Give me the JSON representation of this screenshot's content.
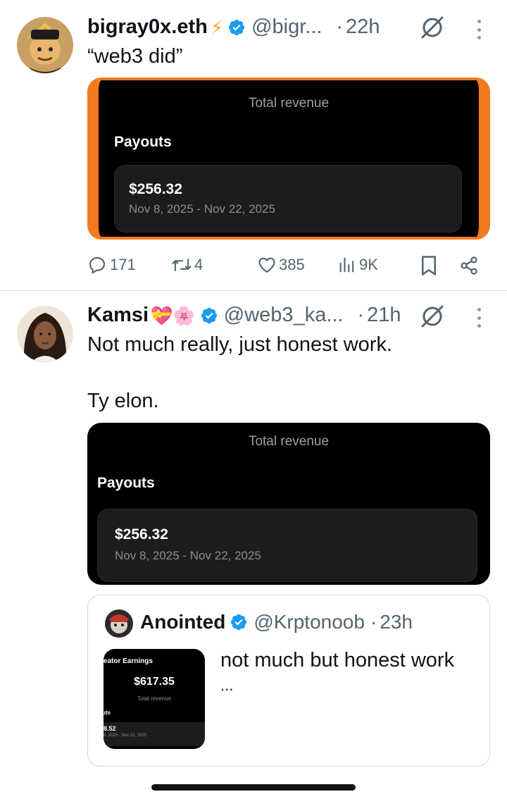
{
  "tweets": [
    {
      "name": "bigray0x.eth",
      "emoji": "⚡",
      "handle": "@bigr...",
      "dot": "·",
      "time": "22h",
      "text": "“web3 did”",
      "media": {
        "title": "Total revenue",
        "section": "Payouts",
        "amount": "$256.32",
        "dates": "Nov 8, 2025 - Nov 22, 2025",
        "border_color": "#f47a20"
      },
      "actions": {
        "replies": "171",
        "reposts": "4",
        "likes": "385",
        "views": "9K"
      }
    },
    {
      "name": "Kamsi",
      "emoji": "💝🌸",
      "handle": "@web3_ka...",
      "dot": "·",
      "time": "21h",
      "text": "Not much really, just honest work.\n\nTy elon.",
      "media": {
        "title": "Total revenue",
        "section": "Payouts",
        "amount": "$256.32",
        "dates": "Nov 8, 2025 - Nov 22, 2025"
      },
      "quote": {
        "name": "Anointed",
        "handle": "@Krptonoob",
        "dot": "·",
        "time": "23h",
        "text": "not much but honest work",
        "ellipsis": "...",
        "thumb": {
          "header": "reator Earnings",
          "amount": "$617.35",
          "caption": "Total revenue",
          "section": "uts",
          "row_amount": "8.52",
          "row_dates": "8, 2025 - Nov 22, 2025"
        }
      }
    }
  ],
  "colors": {
    "verified": "#1d9bf0",
    "text_secondary": "#536471",
    "emoji_lightning": "#f5a623"
  }
}
